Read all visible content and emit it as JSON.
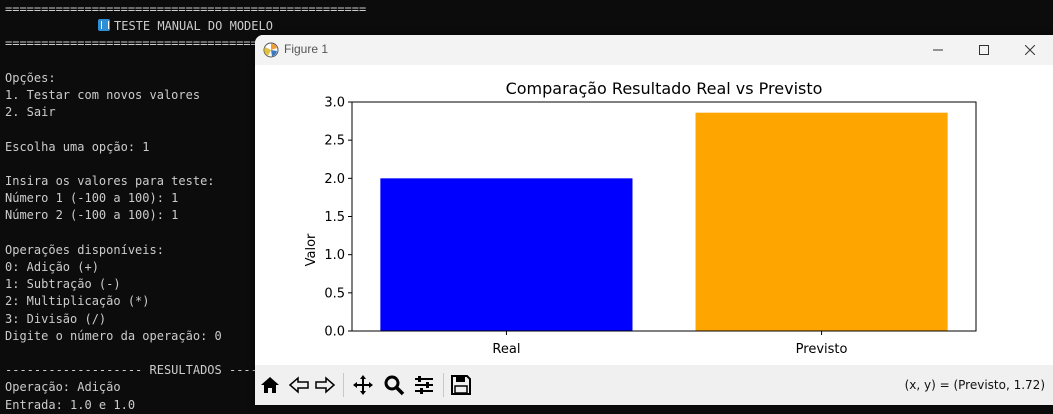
{
  "terminal": {
    "lines": [
      "==================================================",
      "",
      "==================================================",
      "",
      "Opções:",
      "1. Testar com novos valores",
      "2. Sair",
      "",
      "Escolha uma opção: 1",
      "",
      "Insira os valores para teste:",
      "Número 1 (-100 a 100): 1",
      "Número 2 (-100 a 100): 1",
      "",
      "Operações disponíveis:",
      "0: Adição (+)",
      "1: Subtração (-)",
      "2: Multiplicação (*)",
      "3: Divisão (/)",
      "Digite o número da operação: 0",
      "",
      "------------------- RESULTADOS ------------------",
      "Operação: Adição",
      "Entrada: 1.0 e 1.0"
    ],
    "banner": "TESTE MANUAL DO MODELO",
    "banner_icon": "numbers-emoji-icon"
  },
  "window": {
    "title": "Figure 1",
    "icon": "matplotlib-icon"
  },
  "toolbar": {
    "buttons": [
      "home-icon",
      "back-arrow-icon",
      "forward-arrow-icon",
      "pan-icon",
      "zoom-icon",
      "configure-subplots-icon",
      "save-icon"
    ],
    "coords": "(x, y) = (Previsto, 1.72)"
  },
  "chart_data": {
    "type": "bar",
    "title": "Comparação Resultado Real vs Previsto",
    "xlabel": "",
    "ylabel": "Valor",
    "categories": [
      "Real",
      "Previsto"
    ],
    "values": [
      2.0,
      2.86
    ],
    "colors": [
      "#0000ff",
      "#ffa500"
    ],
    "ylim": [
      0,
      3.0
    ],
    "yticks": [
      "0.0",
      "0.5",
      "1.0",
      "1.5",
      "2.0",
      "2.5",
      "3.0"
    ],
    "grid": false
  }
}
